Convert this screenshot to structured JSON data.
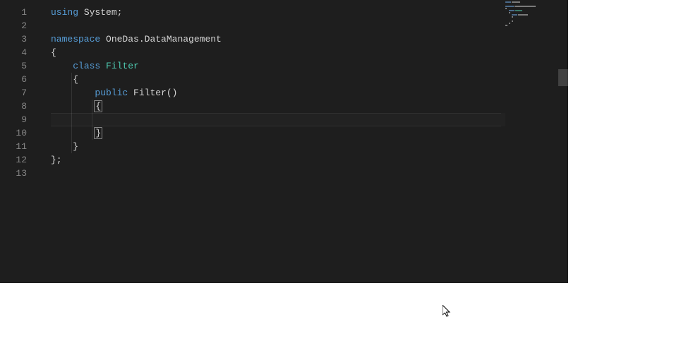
{
  "editor": {
    "lineNumbers": [
      "1",
      "2",
      "3",
      "4",
      "5",
      "6",
      "7",
      "8",
      "9",
      "10",
      "11",
      "12",
      "13"
    ],
    "code": {
      "l1": {
        "kw": "using",
        "sp": " ",
        "name": "System",
        "semi": ";"
      },
      "l2": "",
      "l3": {
        "kw": "namespace",
        "sp": " ",
        "name": "OneDas.DataManagement"
      },
      "l4": {
        "brace": "{"
      },
      "l5": {
        "indent": "    ",
        "kw": "class",
        "sp": " ",
        "name": "Filter"
      },
      "l6": {
        "indent": "    ",
        "brace": "{"
      },
      "l7": {
        "indent": "        ",
        "kw": "public",
        "sp": " ",
        "name": "Filter",
        "parens": "()"
      },
      "l8": {
        "indent": "        ",
        "brace": "{"
      },
      "l9": "",
      "l10": {
        "indent": "        ",
        "brace": "}"
      },
      "l11": {
        "indent": "    ",
        "brace": "}"
      },
      "l12": {
        "brace": "};"
      },
      "l13": ""
    }
  }
}
